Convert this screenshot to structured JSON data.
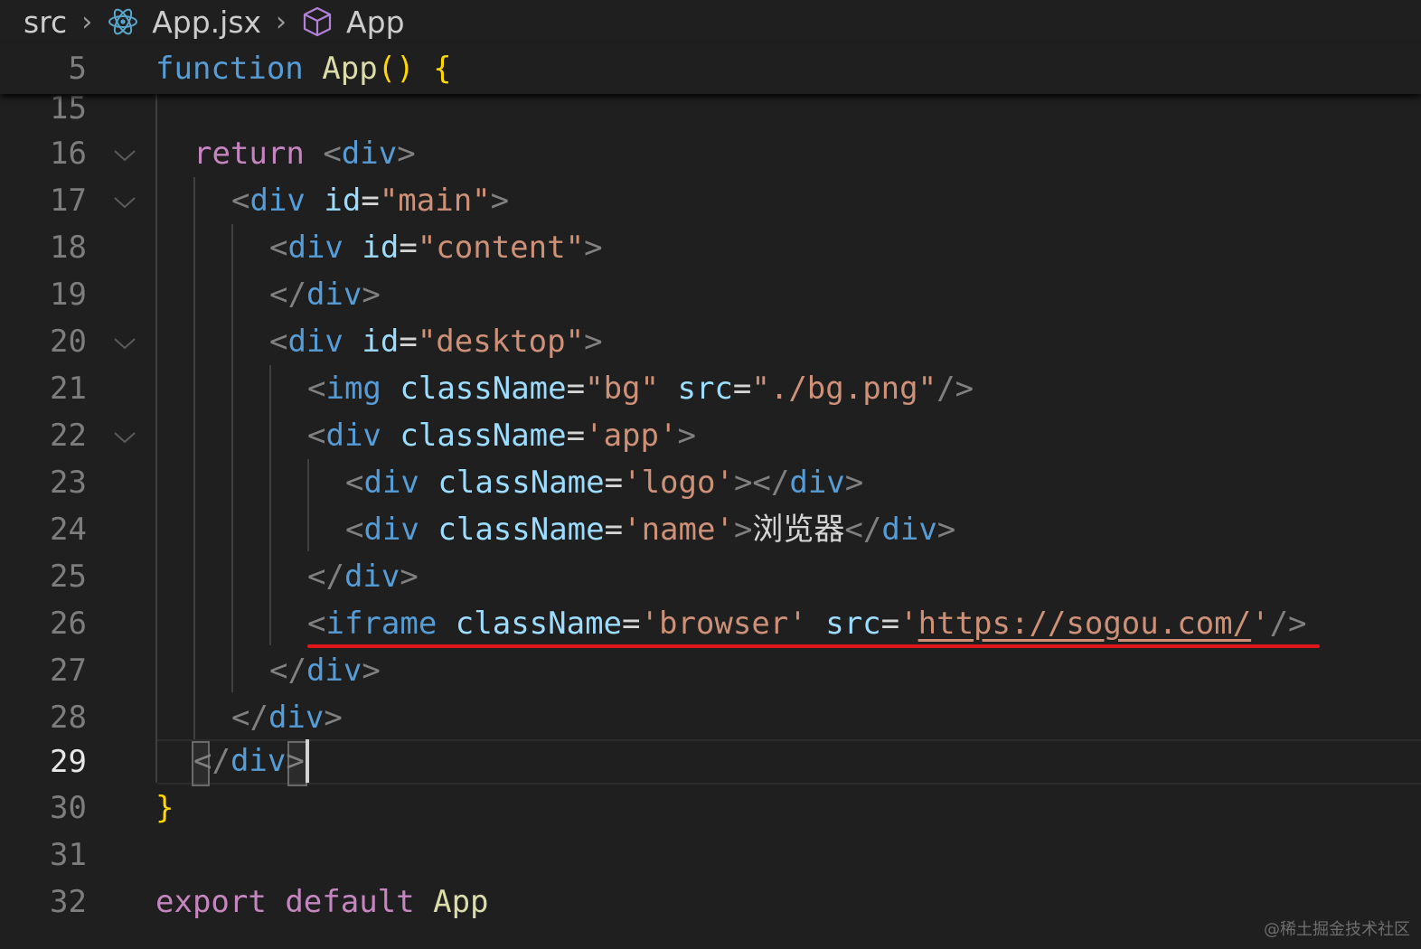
{
  "breadcrumb": {
    "folder": "src",
    "file": "App.jsx",
    "symbol": "App",
    "file_icon": "react-icon",
    "symbol_icon": "cube-icon"
  },
  "sticky_scroll": {
    "line_number": "5",
    "keyword": "function",
    "name": "App",
    "parens": "()",
    "brace": "{"
  },
  "lines": {
    "l15": "15",
    "l16": "16",
    "l17": "17",
    "l18": "18",
    "l19": "19",
    "l20": "20",
    "l21": "21",
    "l22": "22",
    "l23": "23",
    "l24": "24",
    "l25": "25",
    "l26": "26",
    "l27": "27",
    "l28": "28",
    "l29": "29",
    "l30": "30",
    "l31": "31",
    "l32": "32"
  },
  "code": {
    "return_kw": "return",
    "div": "div",
    "img": "img",
    "iframe": "iframe",
    "id_attr": "id",
    "classname_attr": "className",
    "src_attr": "src",
    "main_val": "\"main\"",
    "content_val": "\"content\"",
    "desktop_val": "\"desktop\"",
    "bg_val": "\"bg\"",
    "bg_src_val": "\"./bg.png\"",
    "app_val": "'app'",
    "logo_val": "'logo'",
    "name_val": "'name'",
    "name_text": "浏览器",
    "browser_val": "'browser'",
    "iframe_src_open": "'",
    "iframe_src_url": "https://sogou.com/",
    "iframe_src_close": "'",
    "closing_brace": "}",
    "export_kw": "export",
    "default_kw": "default",
    "export_name": "App"
  },
  "colors": {
    "background": "#1f1f1f",
    "keyword_blue": "#569cd6",
    "keyword_purple": "#c586c0",
    "function_yellow": "#dcdcaa",
    "string_orange": "#ce9178",
    "attribute_lightblue": "#9cdcfe",
    "annotation_red": "#e0141b"
  },
  "active_line": "29",
  "watermark": "@稀土掘金技术社区"
}
